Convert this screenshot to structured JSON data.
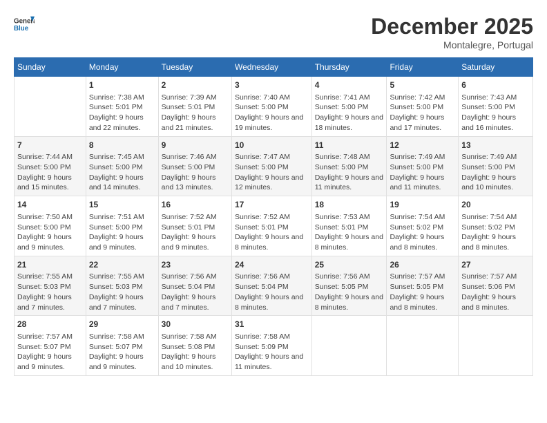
{
  "logo": {
    "text_general": "General",
    "text_blue": "Blue"
  },
  "title": {
    "month_year": "December 2025",
    "location": "Montalegre, Portugal"
  },
  "header_days": [
    "Sunday",
    "Monday",
    "Tuesday",
    "Wednesday",
    "Thursday",
    "Friday",
    "Saturday"
  ],
  "weeks": [
    [
      {
        "day": "",
        "sunrise": "",
        "sunset": "",
        "daylight": ""
      },
      {
        "day": "1",
        "sunrise": "Sunrise: 7:38 AM",
        "sunset": "Sunset: 5:01 PM",
        "daylight": "Daylight: 9 hours and 22 minutes."
      },
      {
        "day": "2",
        "sunrise": "Sunrise: 7:39 AM",
        "sunset": "Sunset: 5:01 PM",
        "daylight": "Daylight: 9 hours and 21 minutes."
      },
      {
        "day": "3",
        "sunrise": "Sunrise: 7:40 AM",
        "sunset": "Sunset: 5:00 PM",
        "daylight": "Daylight: 9 hours and 19 minutes."
      },
      {
        "day": "4",
        "sunrise": "Sunrise: 7:41 AM",
        "sunset": "Sunset: 5:00 PM",
        "daylight": "Daylight: 9 hours and 18 minutes."
      },
      {
        "day": "5",
        "sunrise": "Sunrise: 7:42 AM",
        "sunset": "Sunset: 5:00 PM",
        "daylight": "Daylight: 9 hours and 17 minutes."
      },
      {
        "day": "6",
        "sunrise": "Sunrise: 7:43 AM",
        "sunset": "Sunset: 5:00 PM",
        "daylight": "Daylight: 9 hours and 16 minutes."
      }
    ],
    [
      {
        "day": "7",
        "sunrise": "Sunrise: 7:44 AM",
        "sunset": "Sunset: 5:00 PM",
        "daylight": "Daylight: 9 hours and 15 minutes."
      },
      {
        "day": "8",
        "sunrise": "Sunrise: 7:45 AM",
        "sunset": "Sunset: 5:00 PM",
        "daylight": "Daylight: 9 hours and 14 minutes."
      },
      {
        "day": "9",
        "sunrise": "Sunrise: 7:46 AM",
        "sunset": "Sunset: 5:00 PM",
        "daylight": "Daylight: 9 hours and 13 minutes."
      },
      {
        "day": "10",
        "sunrise": "Sunrise: 7:47 AM",
        "sunset": "Sunset: 5:00 PM",
        "daylight": "Daylight: 9 hours and 12 minutes."
      },
      {
        "day": "11",
        "sunrise": "Sunrise: 7:48 AM",
        "sunset": "Sunset: 5:00 PM",
        "daylight": "Daylight: 9 hours and 11 minutes."
      },
      {
        "day": "12",
        "sunrise": "Sunrise: 7:49 AM",
        "sunset": "Sunset: 5:00 PM",
        "daylight": "Daylight: 9 hours and 11 minutes."
      },
      {
        "day": "13",
        "sunrise": "Sunrise: 7:49 AM",
        "sunset": "Sunset: 5:00 PM",
        "daylight": "Daylight: 9 hours and 10 minutes."
      }
    ],
    [
      {
        "day": "14",
        "sunrise": "Sunrise: 7:50 AM",
        "sunset": "Sunset: 5:00 PM",
        "daylight": "Daylight: 9 hours and 9 minutes."
      },
      {
        "day": "15",
        "sunrise": "Sunrise: 7:51 AM",
        "sunset": "Sunset: 5:00 PM",
        "daylight": "Daylight: 9 hours and 9 minutes."
      },
      {
        "day": "16",
        "sunrise": "Sunrise: 7:52 AM",
        "sunset": "Sunset: 5:01 PM",
        "daylight": "Daylight: 9 hours and 9 minutes."
      },
      {
        "day": "17",
        "sunrise": "Sunrise: 7:52 AM",
        "sunset": "Sunset: 5:01 PM",
        "daylight": "Daylight: 9 hours and 8 minutes."
      },
      {
        "day": "18",
        "sunrise": "Sunrise: 7:53 AM",
        "sunset": "Sunset: 5:01 PM",
        "daylight": "Daylight: 9 hours and 8 minutes."
      },
      {
        "day": "19",
        "sunrise": "Sunrise: 7:54 AM",
        "sunset": "Sunset: 5:02 PM",
        "daylight": "Daylight: 9 hours and 8 minutes."
      },
      {
        "day": "20",
        "sunrise": "Sunrise: 7:54 AM",
        "sunset": "Sunset: 5:02 PM",
        "daylight": "Daylight: 9 hours and 8 minutes."
      }
    ],
    [
      {
        "day": "21",
        "sunrise": "Sunrise: 7:55 AM",
        "sunset": "Sunset: 5:03 PM",
        "daylight": "Daylight: 9 hours and 7 minutes."
      },
      {
        "day": "22",
        "sunrise": "Sunrise: 7:55 AM",
        "sunset": "Sunset: 5:03 PM",
        "daylight": "Daylight: 9 hours and 7 minutes."
      },
      {
        "day": "23",
        "sunrise": "Sunrise: 7:56 AM",
        "sunset": "Sunset: 5:04 PM",
        "daylight": "Daylight: 9 hours and 7 minutes."
      },
      {
        "day": "24",
        "sunrise": "Sunrise: 7:56 AM",
        "sunset": "Sunset: 5:04 PM",
        "daylight": "Daylight: 9 hours and 8 minutes."
      },
      {
        "day": "25",
        "sunrise": "Sunrise: 7:56 AM",
        "sunset": "Sunset: 5:05 PM",
        "daylight": "Daylight: 9 hours and 8 minutes."
      },
      {
        "day": "26",
        "sunrise": "Sunrise: 7:57 AM",
        "sunset": "Sunset: 5:05 PM",
        "daylight": "Daylight: 9 hours and 8 minutes."
      },
      {
        "day": "27",
        "sunrise": "Sunrise: 7:57 AM",
        "sunset": "Sunset: 5:06 PM",
        "daylight": "Daylight: 9 hours and 8 minutes."
      }
    ],
    [
      {
        "day": "28",
        "sunrise": "Sunrise: 7:57 AM",
        "sunset": "Sunset: 5:07 PM",
        "daylight": "Daylight: 9 hours and 9 minutes."
      },
      {
        "day": "29",
        "sunrise": "Sunrise: 7:58 AM",
        "sunset": "Sunset: 5:07 PM",
        "daylight": "Daylight: 9 hours and 9 minutes."
      },
      {
        "day": "30",
        "sunrise": "Sunrise: 7:58 AM",
        "sunset": "Sunset: 5:08 PM",
        "daylight": "Daylight: 9 hours and 10 minutes."
      },
      {
        "day": "31",
        "sunrise": "Sunrise: 7:58 AM",
        "sunset": "Sunset: 5:09 PM",
        "daylight": "Daylight: 9 hours and 11 minutes."
      },
      {
        "day": "",
        "sunrise": "",
        "sunset": "",
        "daylight": ""
      },
      {
        "day": "",
        "sunrise": "",
        "sunset": "",
        "daylight": ""
      },
      {
        "day": "",
        "sunrise": "",
        "sunset": "",
        "daylight": ""
      }
    ]
  ]
}
